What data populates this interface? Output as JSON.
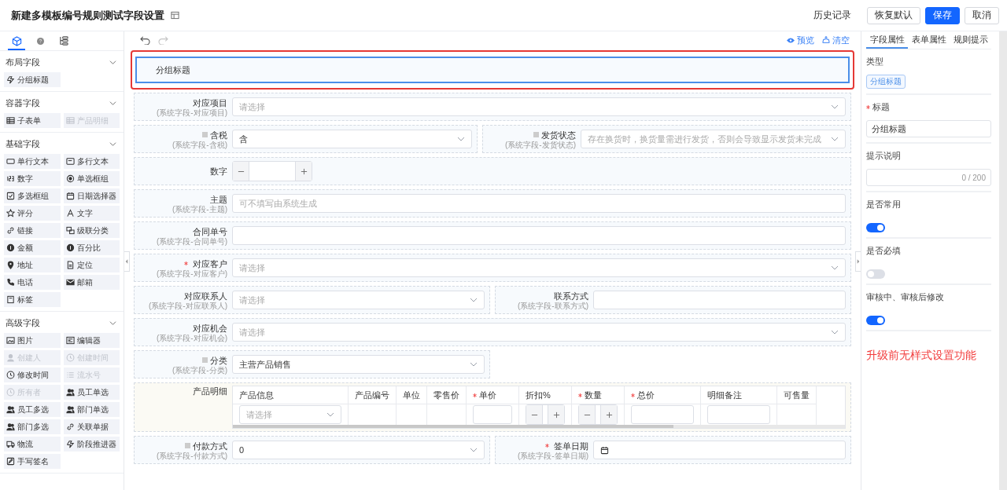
{
  "header": {
    "title": "新建多模板编号规则测试字段设置",
    "history": "历史记录",
    "buttons": [
      {
        "label": "恢复默认",
        "kind": "default"
      },
      {
        "label": "保存",
        "kind": "primary"
      },
      {
        "label": "取消",
        "kind": "default"
      }
    ]
  },
  "palette": {
    "tabs": [
      {
        "selected": true
      },
      {
        "selected": false
      },
      {
        "selected": false
      }
    ],
    "sections": [
      {
        "title": "布局字段",
        "expanded": true,
        "items": [
          {
            "label": "分组标题",
            "disabled": false
          }
        ]
      },
      {
        "title": "容器字段",
        "expanded": true,
        "items": [
          {
            "label": "子表单",
            "disabled": false
          },
          {
            "label": "产品明细",
            "disabled": true
          }
        ]
      },
      {
        "title": "基础字段",
        "expanded": true,
        "items": [
          {
            "label": "单行文本",
            "disabled": false
          },
          {
            "label": "多行文本",
            "disabled": false
          },
          {
            "label": "数字",
            "disabled": false
          },
          {
            "label": "单选框组",
            "disabled": false
          },
          {
            "label": "多选框组",
            "disabled": false
          },
          {
            "label": "日期选择器",
            "disabled": false
          },
          {
            "label": "评分",
            "disabled": false
          },
          {
            "label": "文字",
            "disabled": false
          },
          {
            "label": "链接",
            "disabled": false
          },
          {
            "label": "级联分类",
            "disabled": false
          },
          {
            "label": "金额",
            "disabled": false
          },
          {
            "label": "百分比",
            "disabled": false
          },
          {
            "label": "地址",
            "disabled": false
          },
          {
            "label": "定位",
            "disabled": false
          },
          {
            "label": "电话",
            "disabled": false
          },
          {
            "label": "邮箱",
            "disabled": false
          },
          {
            "label": "标签",
            "disabled": false
          }
        ]
      },
      {
        "title": "高级字段",
        "expanded": true,
        "items": [
          {
            "label": "图片",
            "disabled": false
          },
          {
            "label": "编辑器",
            "disabled": false
          },
          {
            "label": "创建人",
            "disabled": true
          },
          {
            "label": "创建时间",
            "disabled": true
          },
          {
            "label": "修改时间",
            "disabled": false
          },
          {
            "label": "流水号",
            "disabled": true
          },
          {
            "label": "所有者",
            "disabled": true
          },
          {
            "label": "员工单选",
            "disabled": false
          },
          {
            "label": "员工多选",
            "disabled": false
          },
          {
            "label": "部门单选",
            "disabled": false
          },
          {
            "label": "部门多选",
            "disabled": false
          },
          {
            "label": "关联单据",
            "disabled": false
          },
          {
            "label": "物流",
            "disabled": false
          },
          {
            "label": "阶段推进器",
            "disabled": false
          },
          {
            "label": "手写签名",
            "disabled": false
          }
        ]
      }
    ]
  },
  "canvas": {
    "actions": [
      "预览",
      "清空"
    ],
    "group_title": {
      "label": "分组标题",
      "selected": true
    },
    "rows": [
      [
        {
          "kind": "select",
          "label": "对应项目",
          "sublabel": "(系统字段-对应项目)",
          "required": false,
          "square_mark": false,
          "full_width": true,
          "placeholder": "请选择"
        }
      ],
      [
        {
          "kind": "select",
          "label": "含税",
          "sublabel": "(系统字段-含税)",
          "required": false,
          "square_mark": true,
          "full_width": false,
          "value": "含"
        },
        {
          "kind": "select",
          "label": "发货状态",
          "sublabel": "(系统字段-发货状态)",
          "required": false,
          "square_mark": true,
          "full_width": false,
          "placeholder": "存在换货时，换货量需进行发货，否则会导致显示发货未完成"
        }
      ],
      [
        {
          "kind": "number",
          "label": "数字",
          "required": false,
          "square_mark": false,
          "full_width": true
        }
      ],
      [
        {
          "kind": "input",
          "label": "主题",
          "sublabel": "(系统字段-主题)",
          "required": false,
          "square_mark": false,
          "full_width": true,
          "placeholder": "可不填写由系统生成"
        }
      ],
      [
        {
          "kind": "input",
          "label": "合同单号",
          "sublabel": "(系统字段-合同单号)",
          "required": false,
          "square_mark": false,
          "full_width": true
        }
      ],
      [
        {
          "kind": "select",
          "label": "对应客户",
          "sublabel": "(系统字段-对应客户)",
          "required": true,
          "square_mark": false,
          "full_width": true,
          "placeholder": "请选择"
        }
      ],
      [
        {
          "kind": "select",
          "label": "对应联系人",
          "sublabel": "(系统字段-对应联系人)",
          "required": false,
          "square_mark": false,
          "full_width": false,
          "placeholder": "请选择"
        },
        {
          "kind": "input",
          "label": "联系方式",
          "sublabel": "(系统字段-联系方式)",
          "required": false,
          "square_mark": false,
          "full_width": false
        }
      ],
      [
        {
          "kind": "select",
          "label": "对应机会",
          "sublabel": "(系统字段-对应机会)",
          "required": false,
          "square_mark": false,
          "full_width": true,
          "placeholder": "请选择"
        }
      ],
      [
        {
          "kind": "select",
          "label": "分类",
          "sublabel": "(系统字段-分类)",
          "required": false,
          "square_mark": true,
          "full_width": false,
          "value": "主营产品销售"
        }
      ],
      [
        {
          "kind": "table",
          "label": "产品明细",
          "required": false,
          "square_mark": false,
          "full_width": true,
          "columns": [
            {
              "label": "产品信息",
              "required": false
            },
            {
              "label": "产品编号",
              "required": false
            },
            {
              "label": "单位",
              "required": false
            },
            {
              "label": "零售价",
              "required": false
            },
            {
              "label": "单价",
              "required": true
            },
            {
              "label": "折扣%",
              "required": false
            },
            {
              "label": "数量",
              "required": true
            },
            {
              "label": "总价",
              "required": true
            },
            {
              "label": "明细备注",
              "required": false
            },
            {
              "label": "可售量",
              "required": false
            }
          ],
          "cells": [
            {
              "kind": "select",
              "placeholder": "请选择"
            },
            {
              "kind": "empty"
            },
            {
              "kind": "empty"
            },
            {
              "kind": "empty"
            },
            {
              "kind": "input"
            },
            {
              "kind": "number"
            },
            {
              "kind": "number"
            },
            {
              "kind": "input"
            },
            {
              "kind": "input"
            },
            {
              "kind": "empty"
            }
          ]
        }
      ],
      [
        {
          "kind": "select",
          "label": "付款方式",
          "sublabel": "(系统字段-付款方式)",
          "required": false,
          "square_mark": true,
          "full_width": false,
          "value": "0"
        },
        {
          "kind": "date",
          "label": "签单日期",
          "sublabel": "(系统字段-签单日期)",
          "required": true,
          "square_mark": false,
          "full_width": false
        }
      ]
    ]
  },
  "properties": {
    "tabs": [
      {
        "label": "字段属性",
        "selected": true
      },
      {
        "label": "表单属性",
        "selected": false
      },
      {
        "label": "规则提示",
        "selected": false
      }
    ],
    "type_label": "类型",
    "type_tag": "分组标题",
    "title": {
      "label": "标题",
      "required": true,
      "value": "分组标题"
    },
    "hint": {
      "label": "提示说明",
      "counter": "0 / 200"
    },
    "toggles": [
      {
        "label": "是否常用",
        "on": true
      },
      {
        "label": "是否必填",
        "on": false
      },
      {
        "label": "审核中、审核后修改",
        "on": true
      }
    ],
    "note": "升级前无样式设置功能"
  }
}
